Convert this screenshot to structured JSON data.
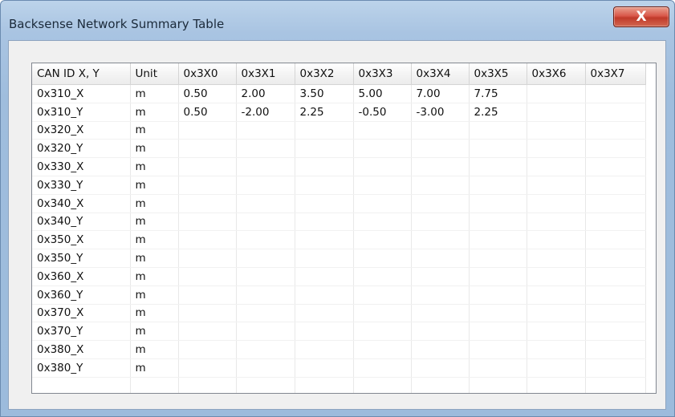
{
  "window": {
    "title": "Backsense Network Summary Table",
    "close_label": "X"
  },
  "table": {
    "columns": [
      "CAN ID X, Y",
      "Unit",
      "0x3X0",
      "0x3X1",
      "0x3X2",
      "0x3X3",
      "0x3X4",
      "0x3X5",
      "0x3X6",
      "0x3X7"
    ],
    "rows": [
      [
        "0x310_X",
        "m",
        "0.50",
        "2.00",
        "3.50",
        "5.00",
        "7.00",
        "7.75",
        "",
        ""
      ],
      [
        "0x310_Y",
        "m",
        "0.50",
        "-2.00",
        "2.25",
        "-0.50",
        "-3.00",
        "2.25",
        "",
        ""
      ],
      [
        "0x320_X",
        "m",
        "",
        "",
        "",
        "",
        "",
        "",
        "",
        ""
      ],
      [
        "0x320_Y",
        "m",
        "",
        "",
        "",
        "",
        "",
        "",
        "",
        ""
      ],
      [
        "0x330_X",
        "m",
        "",
        "",
        "",
        "",
        "",
        "",
        "",
        ""
      ],
      [
        "0x330_Y",
        "m",
        "",
        "",
        "",
        "",
        "",
        "",
        "",
        ""
      ],
      [
        "0x340_X",
        "m",
        "",
        "",
        "",
        "",
        "",
        "",
        "",
        ""
      ],
      [
        "0x340_Y",
        "m",
        "",
        "",
        "",
        "",
        "",
        "",
        "",
        ""
      ],
      [
        "0x350_X",
        "m",
        "",
        "",
        "",
        "",
        "",
        "",
        "",
        ""
      ],
      [
        "0x350_Y",
        "m",
        "",
        "",
        "",
        "",
        "",
        "",
        "",
        ""
      ],
      [
        "0x360_X",
        "m",
        "",
        "",
        "",
        "",
        "",
        "",
        "",
        ""
      ],
      [
        "0x360_Y",
        "m",
        "",
        "",
        "",
        "",
        "",
        "",
        "",
        ""
      ],
      [
        "0x370_X",
        "m",
        "",
        "",
        "",
        "",
        "",
        "",
        "",
        ""
      ],
      [
        "0x370_Y",
        "m",
        "",
        "",
        "",
        "",
        "",
        "",
        "",
        ""
      ],
      [
        "0x380_X",
        "m",
        "",
        "",
        "",
        "",
        "",
        "",
        "",
        ""
      ],
      [
        "0x380_Y",
        "m",
        "",
        "",
        "",
        "",
        "",
        "",
        "",
        ""
      ]
    ]
  },
  "colors": {
    "titlebar": "#a9c4e2",
    "close_button": "#c03a2a",
    "client_background": "#f0f0f0"
  }
}
